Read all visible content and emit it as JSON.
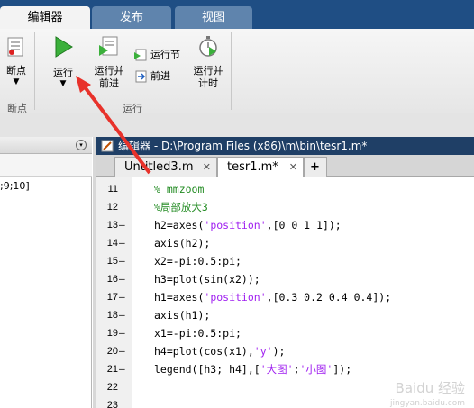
{
  "ribbon_tabs": [
    "编辑器",
    "发布",
    "视图"
  ],
  "ribbon": {
    "breakpoints_label": "断点",
    "breakpoints_group": "断点",
    "run_label": "运行",
    "run_advance_label": "运行并\n前进",
    "run_section_label": "运行节",
    "advance_label": "前进",
    "run_time_label": "运行并\n计时",
    "run_group": "运行"
  },
  "left_panel": {
    "text": ";9;10]"
  },
  "editor": {
    "title": "编辑器 - D:\\Program Files (x86)\\m\\bin\\tesr1.m*",
    "tabs": [
      {
        "label": "Untitled3.m",
        "active": false
      },
      {
        "label": "tesr1.m*",
        "active": true
      }
    ],
    "add_tab": "+",
    "lines": [
      {
        "num": "11",
        "dash": "",
        "segments": [
          {
            "t": "% mmzoom",
            "c": "cmt"
          }
        ]
      },
      {
        "num": "12",
        "dash": "",
        "segments": [
          {
            "t": "%局部放大3",
            "c": "cmt"
          }
        ]
      },
      {
        "num": "13",
        "dash": "—",
        "segments": [
          {
            "t": "h2=axes(",
            "c": ""
          },
          {
            "t": "'position'",
            "c": "str"
          },
          {
            "t": ",[0 0 1 1]);",
            "c": ""
          }
        ]
      },
      {
        "num": "14",
        "dash": "—",
        "segments": [
          {
            "t": "axis(h2);",
            "c": ""
          }
        ]
      },
      {
        "num": "15",
        "dash": "—",
        "segments": [
          {
            "t": "x2=-pi:0.5:pi;",
            "c": ""
          }
        ]
      },
      {
        "num": "16",
        "dash": "—",
        "segments": [
          {
            "t": "h3=plot(sin(x2));",
            "c": ""
          }
        ]
      },
      {
        "num": "17",
        "dash": "—",
        "segments": [
          {
            "t": "h1=axes(",
            "c": ""
          },
          {
            "t": "'position'",
            "c": "str"
          },
          {
            "t": ",[0.3 0.2 0.4 0.4]);",
            "c": ""
          }
        ]
      },
      {
        "num": "18",
        "dash": "—",
        "segments": [
          {
            "t": "axis(h1);",
            "c": ""
          }
        ]
      },
      {
        "num": "19",
        "dash": "—",
        "segments": [
          {
            "t": "x1=-pi:0.5:pi;",
            "c": ""
          }
        ]
      },
      {
        "num": "20",
        "dash": "—",
        "segments": [
          {
            "t": "h4=plot(cos(x1),",
            "c": ""
          },
          {
            "t": "'y'",
            "c": "str"
          },
          {
            "t": ");",
            "c": ""
          }
        ]
      },
      {
        "num": "21",
        "dash": "—",
        "segments": [
          {
            "t": "legend([h3; h4],[",
            "c": ""
          },
          {
            "t": "'大图'",
            "c": "str"
          },
          {
            "t": ";",
            "c": ""
          },
          {
            "t": "'小图'",
            "c": "str"
          },
          {
            "t": "]);",
            "c": ""
          }
        ]
      },
      {
        "num": "22",
        "dash": "",
        "segments": []
      },
      {
        "num": "23",
        "dash": "",
        "segments": []
      }
    ]
  },
  "watermark": {
    "main": "Baidu 经验",
    "sub": "jingyan.baidu.com"
  }
}
